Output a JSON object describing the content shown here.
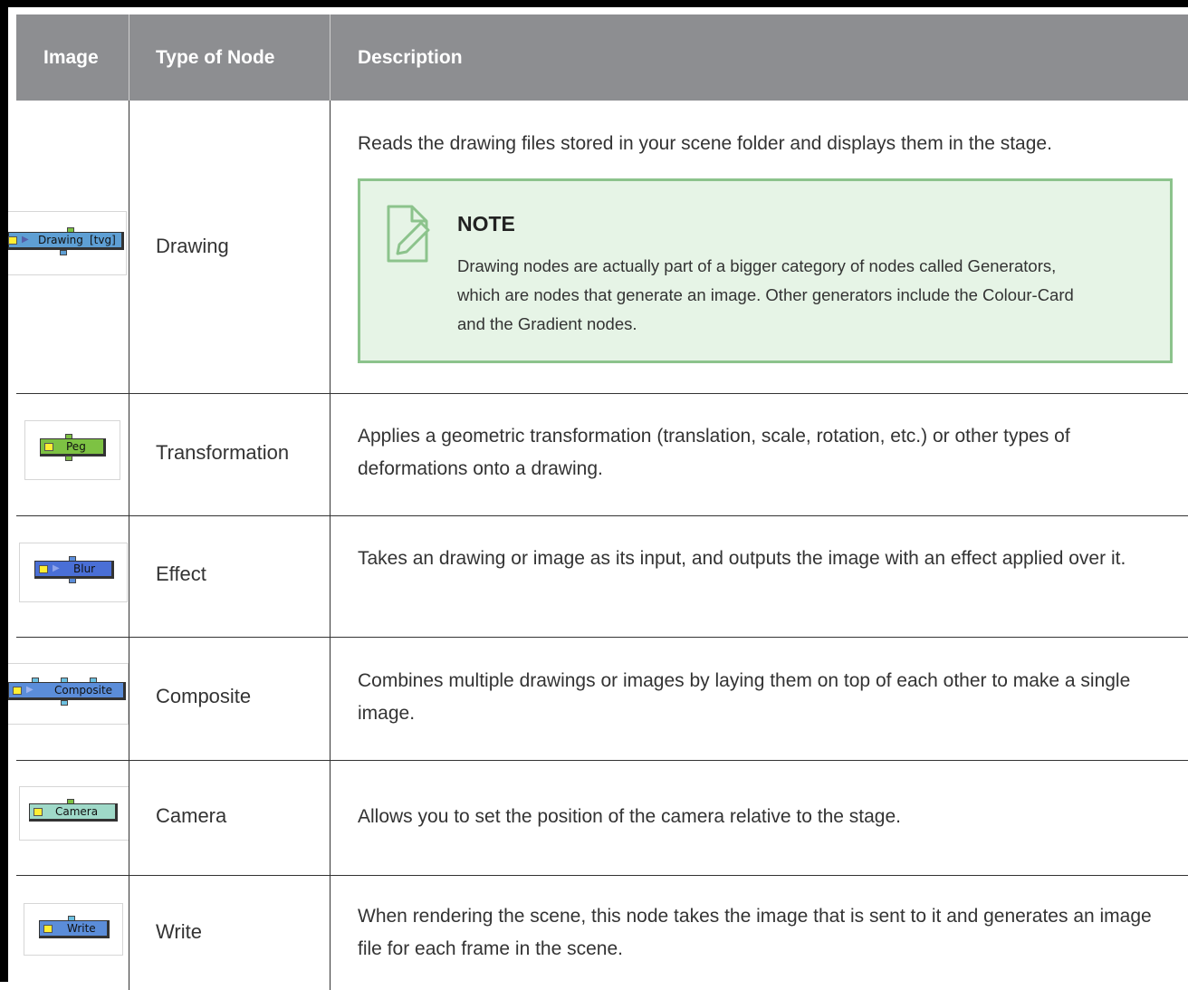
{
  "table": {
    "headers": {
      "image": "Image",
      "type": "Type of Node",
      "description": "Description"
    },
    "rows": [
      {
        "type": "Drawing",
        "description": "Reads the drawing files stored in your scene folder and displays them in the stage.",
        "thumbnail": {
          "label": "Drawing",
          "suffix": "[tvg]",
          "color": "#5e9fd4"
        },
        "note": {
          "title": "NOTE",
          "body": "Drawing nodes are actually part of a bigger category of nodes called Generators, which are nodes that generate an image. Other generators include the Colour-Card and the Gradient nodes."
        }
      },
      {
        "type": "Transformation",
        "description": "Applies a geometric transformation (translation, scale, rotation, etc.) or other types of deformations onto a drawing.",
        "thumbnail": {
          "label": "Peg",
          "color": "#7dc243"
        }
      },
      {
        "type": "Effect",
        "description": "Takes an drawing or image as its input, and outputs the image with an effect applied over it.",
        "thumbnail": {
          "label": "Blur",
          "color": "#4a6fd6"
        }
      },
      {
        "type": "Composite",
        "description": "Combines multiple drawings or images by laying them on top of each other to make a single image.",
        "thumbnail": {
          "label": "Composite",
          "color": "#5b8dd9"
        }
      },
      {
        "type": "Camera",
        "description": "Allows you to set the position of the camera relative to the stage.",
        "thumbnail": {
          "label": "Camera",
          "color": "#9fd9c8"
        }
      },
      {
        "type": "Write",
        "description": "When rendering the scene, this node takes the image that is sent to it and generates an image file for each frame in the scene.",
        "thumbnail": {
          "label": "Write",
          "color": "#5b8dd9"
        }
      }
    ]
  }
}
